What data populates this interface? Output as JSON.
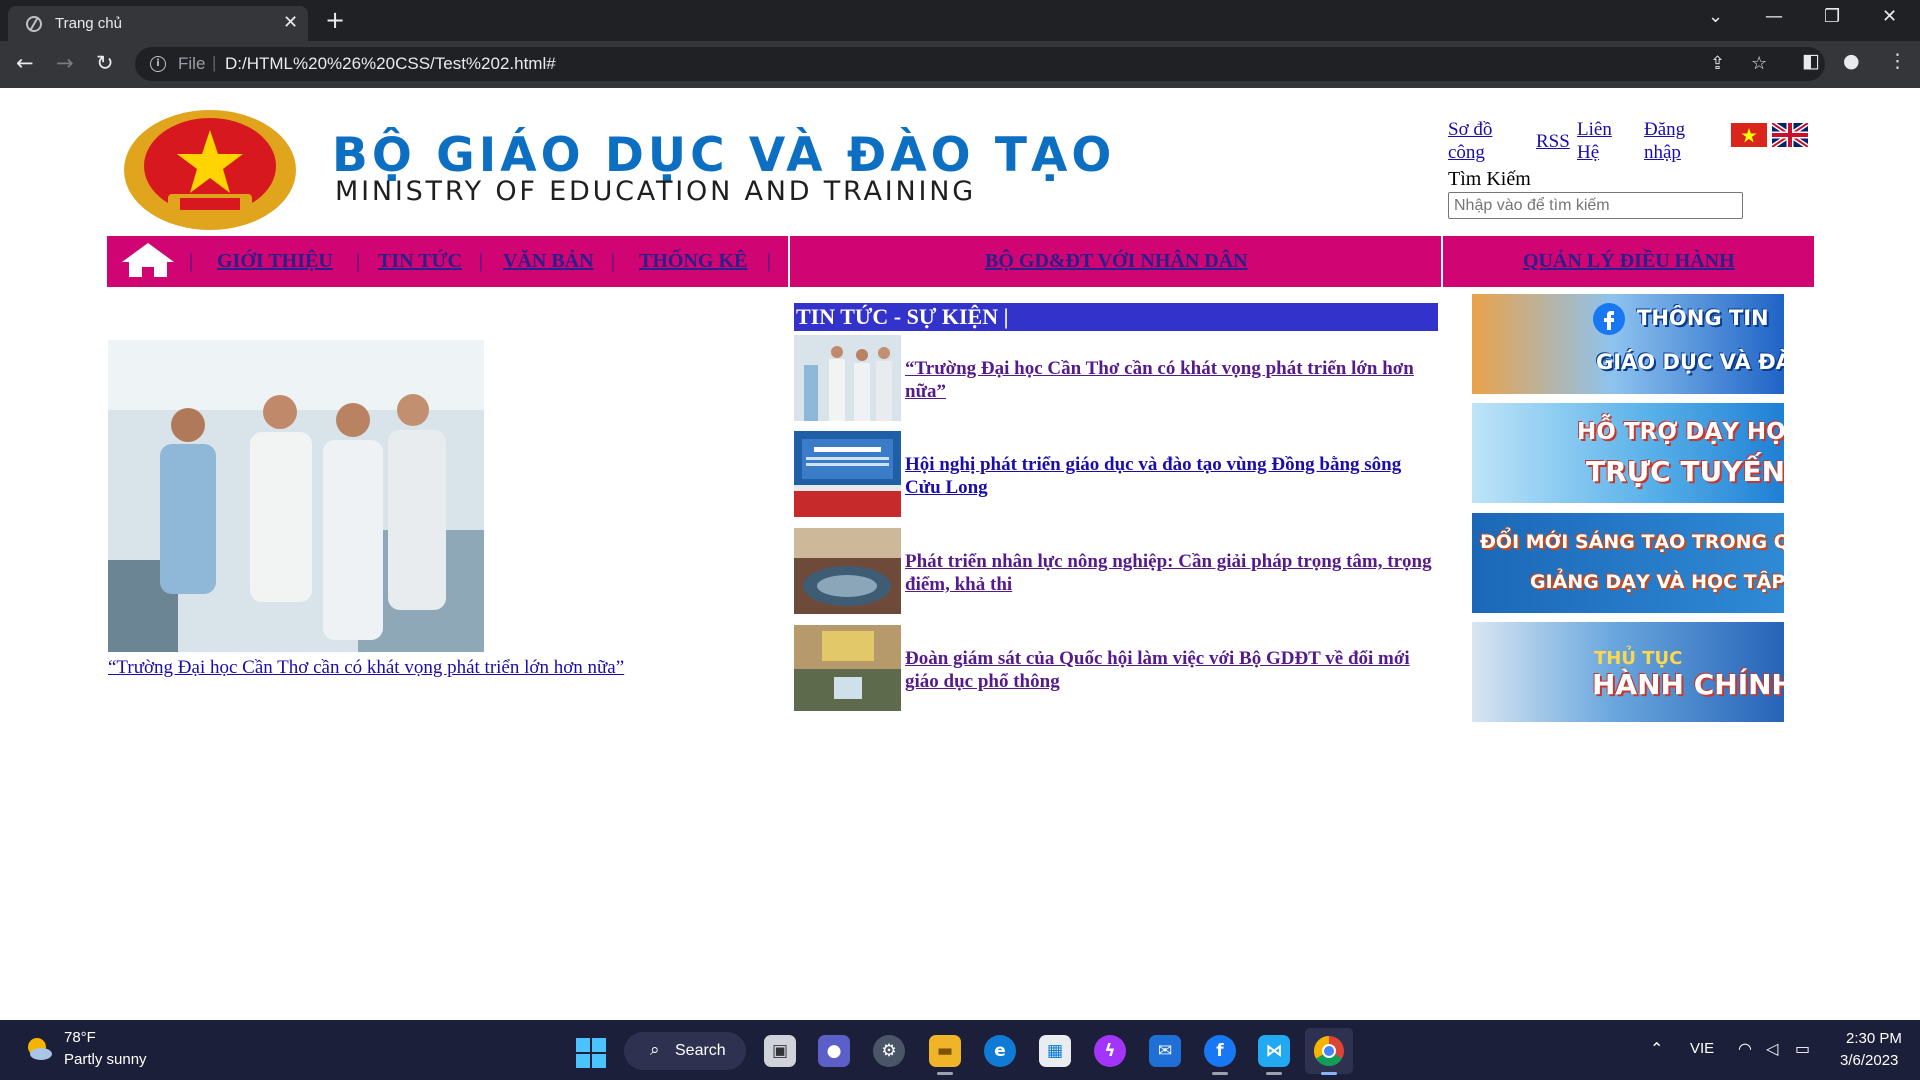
{
  "browser": {
    "tab_title": "Trang chủ",
    "omnibox_scheme": "File",
    "url": "D:/HTML%20%26%20CSS/Test%202.html#"
  },
  "header": {
    "title_vi": "BỘ GIÁO DỤC VÀ ĐÀO TẠO",
    "title_en": "MINISTRY OF EDUCATION AND TRAINING",
    "links": [
      "Sơ đồ công",
      "RSS",
      "Liên Hệ",
      "Đăng nhập"
    ],
    "search_label": "Tìm Kiếm",
    "search_placeholder": "Nhập vào để tìm kiếm"
  },
  "menu": {
    "items": [
      "GIỚI THIỆU",
      "TIN TỨC",
      "VĂN BẢN",
      "THỐNG KÊ"
    ],
    "center_item": "BỘ GD&ĐT VỚI NHÂN DÂN",
    "right_item": "QUẢN LÝ ĐIỀU HÀNH"
  },
  "feature": {
    "caption": "“Trường Đại học Cần Thơ cần có khát vọng phát triển lớn hơn nữa”"
  },
  "news": {
    "heading": "TIN TỨC - SỰ KIỆN |",
    "items": [
      "“Trường Đại học Cần Thơ cần có khát vọng phát triển lớn hơn nữa”",
      "Hội nghị phát triển giáo dục và đào tạo vùng Đồng bằng sông Cửu Long",
      "Phát triển nhân lực nông nghiệp: Cần giải pháp trọng tâm, trọng điểm, khả thi",
      "Đoàn giám sát của Quốc hội làm việc với Bộ GDĐT về đổi mới giáo dục phổ thông"
    ]
  },
  "banners": [
    {
      "line1": "THÔNG TIN",
      "line2": "GIÁO DỤC VÀ ĐÀO TẠO"
    },
    {
      "line1": "HỖ TRỢ DẠY HỌC",
      "line2": "TRỰC TUYẾN"
    },
    {
      "line1": "ĐỔI MỚI SÁNG TẠO TRONG QUẢN LÝ,",
      "line2": "GIẢNG DẠY VÀ HỌC TẬP"
    },
    {
      "line1": "THỦ TỤC",
      "line2": "HÀNH CHÍNH"
    }
  ],
  "taskbar": {
    "temperature": "78°F",
    "weather": "Partly sunny",
    "search_label": "Search",
    "language": "VIE",
    "time": "2:30 PM",
    "date": "3/6/2023"
  },
  "colors": {
    "menu_bg": "#d00472",
    "news_heading_bg": "#3333cc",
    "title_blue": "#0d6fc1"
  }
}
